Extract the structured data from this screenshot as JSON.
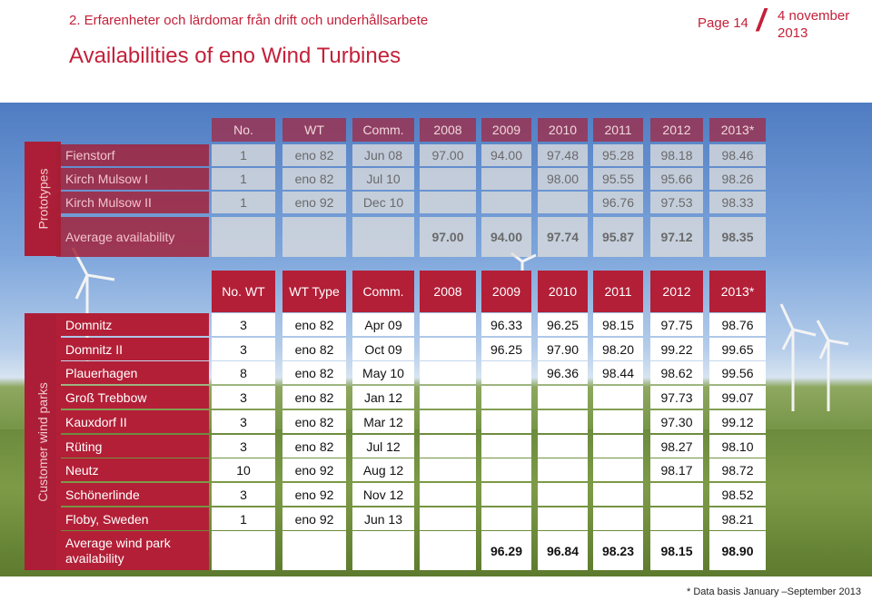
{
  "header": {
    "section": "2. Erfarenheter och lärdomar från drift och underhållsarbete",
    "page": "Page 14",
    "date": "4 november 2013",
    "title": "Availabilities of eno Wind Turbines",
    "footnote": "* Data basis January –September 2013"
  },
  "colors": {
    "accent": "#b31f37"
  },
  "prototypes": {
    "label": "Prototypes",
    "headers": [
      "No.",
      "WT",
      "Comm.",
      "2008",
      "2009",
      "2010",
      "2011",
      "2012",
      "2013*"
    ],
    "rows": [
      {
        "name": "Fienstorf",
        "cells": [
          "1",
          "eno 82",
          "Jun 08",
          "97.00",
          "94.00",
          "97.48",
          "95.28",
          "98.18",
          "98.46"
        ]
      },
      {
        "name": "Kirch Mulsow I",
        "cells": [
          "1",
          "eno 82",
          "Jul 10",
          "",
          "",
          "98.00",
          "95.55",
          "95.66",
          "98.26"
        ]
      },
      {
        "name": "Kirch Mulsow II",
        "cells": [
          "1",
          "eno 92",
          "Dec 10",
          "",
          "",
          "",
          "96.76",
          "97.53",
          "98.33"
        ]
      }
    ],
    "average": {
      "name": "Average availability",
      "cells": [
        "",
        "",
        "",
        "97.00",
        "94.00",
        "97.74",
        "95.87",
        "97.12",
        "98.35"
      ]
    }
  },
  "customer": {
    "label": "Customer wind parks",
    "headers": [
      "No. WT",
      "WT Type",
      "Comm.",
      "2008",
      "2009",
      "2010",
      "2011",
      "2012",
      "2013*"
    ],
    "rows": [
      {
        "name": "Domnitz",
        "cells": [
          "3",
          "eno 82",
          "Apr 09",
          "",
          "96.33",
          "96.25",
          "98.15",
          "97.75",
          "98.76"
        ]
      },
      {
        "name": "Domnitz II",
        "cells": [
          "3",
          "eno 82",
          "Oct 09",
          "",
          "96.25",
          "97.90",
          "98.20",
          "99.22",
          "99.65"
        ]
      },
      {
        "name": "Plauerhagen",
        "cells": [
          "8",
          "eno 82",
          "May 10",
          "",
          "",
          "96.36",
          "98.44",
          "98.62",
          "99.56"
        ]
      },
      {
        "name": "Groß Trebbow",
        "cells": [
          "3",
          "eno 82",
          "Jan 12",
          "",
          "",
          "",
          "",
          "97.73",
          "99.07"
        ]
      },
      {
        "name": "Kauxdorf II",
        "cells": [
          "3",
          "eno 82",
          "Mar 12",
          "",
          "",
          "",
          "",
          "97.30",
          "99.12"
        ]
      },
      {
        "name": "Rüting",
        "cells": [
          "3",
          "eno 82",
          "Jul 12",
          "",
          "",
          "",
          "",
          "98.27",
          "98.10"
        ]
      },
      {
        "name": "Neutz",
        "cells": [
          "10",
          "eno 92",
          "Aug 12",
          "",
          "",
          "",
          "",
          "98.17",
          "98.72"
        ]
      },
      {
        "name": "Schönerlinde",
        "cells": [
          "3",
          "eno 92",
          "Nov 12",
          "",
          "",
          "",
          "",
          "",
          "98.52"
        ]
      },
      {
        "name": "Floby, Sweden",
        "cells": [
          "1",
          "eno 92",
          "Jun 13",
          "",
          "",
          "",
          "",
          "",
          "98.21"
        ]
      }
    ],
    "average": {
      "name": "Average wind park availability",
      "cells": [
        "",
        "",
        "",
        "",
        "96.29",
        "96.84",
        "98.23",
        "98.15",
        "98.90"
      ]
    }
  }
}
